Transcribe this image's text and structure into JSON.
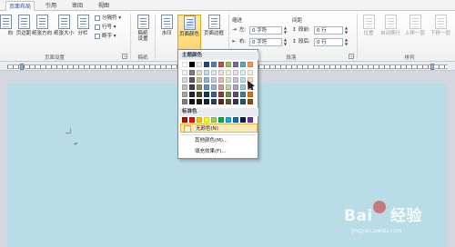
{
  "tabs": [
    "页面布局",
    "引用",
    "审阅",
    "视图"
  ],
  "ribbon": {
    "page_setup": {
      "group_label": "页面设置",
      "buttons": [
        "页边距",
        "纸张方向",
        "纸张大小",
        "分栏"
      ],
      "small": [
        "分隔符",
        "行号",
        "断字"
      ],
      "left_cut_label": "向"
    },
    "draft": {
      "group_label": "稿纸",
      "button": "稿纸\n设置"
    },
    "page_background": {
      "group_label": "页面背景",
      "watermark": "水印",
      "page_color": "页面颜色",
      "page_border": "页面边框"
    },
    "paragraph": {
      "group_label": "段落",
      "indent_head": "缩进",
      "spacing_head": "间距",
      "indent_left_label": "左:",
      "indent_left_value": "0 字符",
      "indent_right_label": "右:",
      "indent_right_value": "0 字符",
      "spacing_before_label": "段前:",
      "spacing_before_value": "0 行",
      "spacing_after_label": "段后:",
      "spacing_after_value": "0 行"
    },
    "arrange": {
      "group_label": "排列",
      "buttons": [
        "位置",
        "自动换行",
        "上移一层",
        "下移一层"
      ]
    }
  },
  "dropdown": {
    "theme_colors_header": "主题颜色",
    "standard_colors_header": "标准色",
    "no_color": "无颜色(N)",
    "more_colors": "其他颜色(M)...",
    "fill_effects": "填充效果(F)...",
    "theme_columns": [
      [
        "#ffffff",
        "#f2f2f2",
        "#d9d9d9",
        "#bfbfbf",
        "#a6a6a6",
        "#808080"
      ],
      [
        "#000000",
        "#7f7f7f",
        "#595959",
        "#404040",
        "#262626",
        "#0d0d0d"
      ],
      [
        "#eeece1",
        "#ddd9c3",
        "#c4bd97",
        "#948a54",
        "#4a452a",
        "#1e1c11"
      ],
      [
        "#1f497d",
        "#c6d9f0",
        "#8db3e2",
        "#548dd4",
        "#17365d",
        "#0f243e"
      ],
      [
        "#4f81bd",
        "#dbe5f1",
        "#b8cce4",
        "#95b3d7",
        "#366092",
        "#244061"
      ],
      [
        "#c0504d",
        "#f2dcdb",
        "#e5b9b7",
        "#d99694",
        "#953734",
        "#632423"
      ],
      [
        "#9bbb59",
        "#ebf1dd",
        "#d7e3bc",
        "#c3d69b",
        "#76923c",
        "#4f6128"
      ],
      [
        "#8064a2",
        "#e5e0ec",
        "#ccc1d9",
        "#b2a2c7",
        "#5f497a",
        "#3f3151"
      ],
      [
        "#4bacc6",
        "#dbeef3",
        "#b7dde8",
        "#92cddc",
        "#31859b",
        "#205867"
      ],
      [
        "#f79646",
        "#fdeada",
        "#fbd5b5",
        "#fac08f",
        "#e36c09",
        "#974806"
      ]
    ],
    "standard_colors": [
      "#c00000",
      "#ff0000",
      "#ffc000",
      "#ffff00",
      "#92d050",
      "#00b050",
      "#00b0f0",
      "#0070c0",
      "#002060",
      "#7030a0"
    ]
  },
  "document": {
    "paragraph_mark": "↵",
    "page_color": "#b8dde7"
  },
  "watermark": {
    "brand": "Bai",
    "brand_suffix": "经验",
    "url": "jingyan.baidu.com"
  }
}
